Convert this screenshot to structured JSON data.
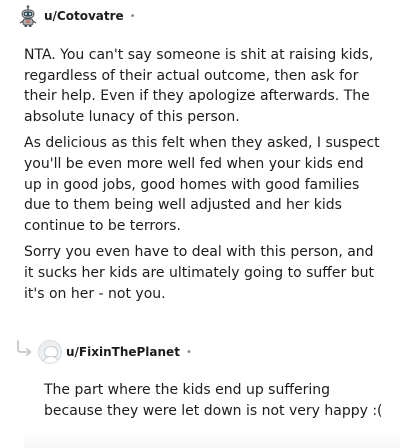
{
  "comments": [
    {
      "username": "u/Cotovatre",
      "separator": "•",
      "paragraphs": [
        "NTA. You can't say someone is shit at raising kids, regardless of their actual outcome, then ask for their help. Even if they apologize afterwards. The absolute lunacy of this person.",
        "As delicious as this felt when they asked, I suspect you'll be even more well fed when your kids end up in good jobs, good homes with good families due to them being well adjusted and her kids continue to be terrors.",
        "Sorry you even have to deal with this person, and it sucks her kids are ultimately going to suffer but it's on her - not you."
      ],
      "avatar_icon": "snoo-robot-avatar-icon"
    },
    {
      "username": "u/FixinThePlanet",
      "separator": "•",
      "paragraphs": [
        "The part where the kids end up suffering because they were let down is not very happy :("
      ],
      "avatar_icon": "default-avatar-icon",
      "reply_icon": "reply-arrow-icon"
    }
  ],
  "colors": {
    "text": "#1c1c1c",
    "meta": "#878a8c",
    "avatar_bg": "#edeff1"
  }
}
